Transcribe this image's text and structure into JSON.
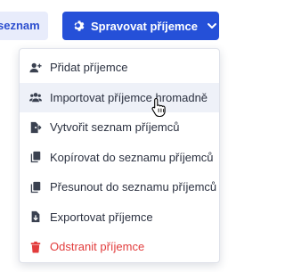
{
  "toolbar": {
    "left_chip_label": "seznam",
    "manage_button_label": "Spravovat příjemce"
  },
  "menu": {
    "items": [
      {
        "label": "Přidat příjemce",
        "icon": "user-plus-icon"
      },
      {
        "label": "Importovat příjemce hromadně",
        "icon": "users-icon"
      },
      {
        "label": "Vytvořit seznam příjemců",
        "icon": "file-export-icon"
      },
      {
        "label": "Kopírovat do seznamu příjemců",
        "icon": "copy-icon"
      },
      {
        "label": "Přesunout do seznamu příjemců",
        "icon": "copy-icon"
      },
      {
        "label": "Exportovat příjemce",
        "icon": "file-download-icon"
      },
      {
        "label": "Odstranit příjemce",
        "icon": "trash-icon"
      }
    ]
  },
  "colors": {
    "primary": "#2550d8",
    "chip_bg": "#e8ecfb",
    "danger": "#e23c3c",
    "text": "#2b3140",
    "hover_bg": "#eef1f8"
  }
}
